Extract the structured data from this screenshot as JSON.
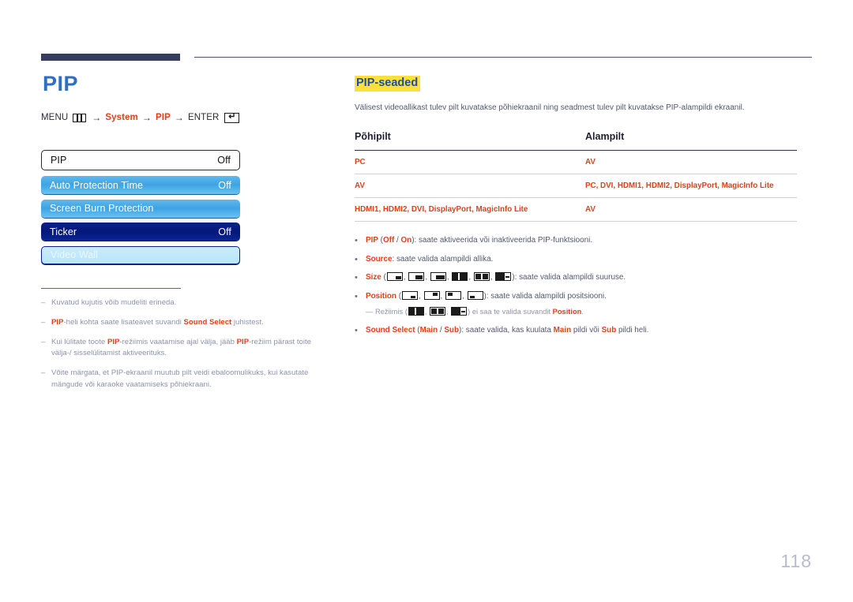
{
  "page": {
    "number": "118"
  },
  "left": {
    "title": "PIP",
    "menu_path": {
      "menu_label": "MENU",
      "menu_icon": "menu-bars-icon",
      "arrow": "→",
      "step1": "System",
      "step2": "PIP",
      "enter_label": "ENTER",
      "enter_icon": "enter-key-icon",
      "enter_glyph": "↵"
    },
    "osd": {
      "rows": [
        {
          "label": "PIP",
          "value": "Off",
          "style": "first"
        },
        {
          "label": "Auto Protection Time",
          "value": "Off",
          "style": "lightblue"
        },
        {
          "label": "Screen Burn Protection",
          "value": "",
          "style": "lightblue"
        },
        {
          "label": "Ticker",
          "value": "Off",
          "style": "darkblue"
        },
        {
          "label": "Video Wall",
          "value": "",
          "style": "paleblue"
        }
      ]
    },
    "notes": [
      {
        "dash": "–",
        "parts": [
          {
            "t": "Kuvatud kujutis võib mudeliti erineda.",
            "b": false
          }
        ]
      },
      {
        "dash": "–",
        "parts": [
          {
            "t": "PIP",
            "b": true
          },
          {
            "t": "-heli kohta saate lisateavet suvandi ",
            "b": false
          },
          {
            "t": "Sound Select",
            "b": true
          },
          {
            "t": " juhistest.",
            "b": false
          }
        ]
      },
      {
        "dash": "–",
        "parts": [
          {
            "t": "Kui lülitate toote ",
            "b": false
          },
          {
            "t": "PIP",
            "b": true
          },
          {
            "t": "-režiimis vaatamise ajal välja, jääb ",
            "b": false
          },
          {
            "t": "PIP",
            "b": true
          },
          {
            "t": "-režiim pärast toite välja-/ sisselülitamist aktiveerituks.",
            "b": false
          }
        ]
      },
      {
        "dash": "–",
        "parts": [
          {
            "t": "Võite märgata, et PIP-ekraanil muutub pilt veidi ebaloomulikuks, kui kasutate mängude või karaoke vaatamiseks põhiekraani.",
            "b": false
          }
        ]
      }
    ]
  },
  "right": {
    "section_title": "PIP-seaded",
    "section_desc": "Välisest videoallikast tulev pilt kuvatakse põhiekraanil ning seadmest tulev pilt kuvatakse PIP-alampildi ekraanil.",
    "table": {
      "headers": [
        "Põhipilt",
        "Alampilt"
      ],
      "rows": [
        [
          "PC",
          "AV"
        ],
        [
          "AV",
          "PC, DVI, HDMI1, HDMI2, DisplayPort, MagicInfo Lite"
        ],
        [
          "HDMI1, HDMI2, DVI, DisplayPort, MagicInfo Lite",
          "AV"
        ]
      ]
    },
    "bullets": [
      {
        "dot": "•",
        "parts": [
          {
            "t": "PIP",
            "b": true
          },
          {
            "t": " (",
            "b": false
          },
          {
            "t": "Off",
            "b": true
          },
          {
            "t": " / ",
            "b": false
          },
          {
            "t": "On",
            "b": true
          },
          {
            "t": "): saate aktiveerida või inaktiveerida PIP-funktsiooni.",
            "b": false
          }
        ]
      },
      {
        "dot": "•",
        "parts": [
          {
            "t": "Source",
            "b": true
          },
          {
            "t": ": saate valida alampildi allika.",
            "b": false
          }
        ]
      }
    ],
    "size_bullet": {
      "dot": "•",
      "label": "Size",
      "open": " (",
      "sep": ", ",
      "close": "): ",
      "tail": "saate valida alampildi suuruse.",
      "icons": [
        "pip-size-small-icon",
        "pip-size-medium-icon",
        "pip-size-large-icon",
        "pip-size-split-wide-icon",
        "pip-size-split-even-icon",
        "pip-size-split-narrow-icon"
      ]
    },
    "position_bullet": {
      "dot": "•",
      "label": "Position",
      "open": " (",
      "sep": ", ",
      "close": "): ",
      "tail": "saate valida alampildi positsiooni.",
      "icons": [
        "pip-position-bottom-right-icon",
        "pip-position-top-right-icon",
        "pip-position-top-left-icon",
        "pip-position-bottom-left-icon"
      ]
    },
    "position_subnote": {
      "dash": "—",
      "pre": "Režiimis (",
      "sep": ", ",
      "mid": ") ei saa te valida suvandit ",
      "bold_end": "Position",
      "end": ".",
      "icons": [
        "pip-size-split-wide-icon",
        "pip-size-split-even-icon",
        "pip-size-split-narrow-icon"
      ]
    },
    "sound_bullet": {
      "dot": "•",
      "parts": [
        {
          "t": "Sound Select",
          "b": true
        },
        {
          "t": " (",
          "b": false
        },
        {
          "t": "Main",
          "b": true
        },
        {
          "t": " / ",
          "b": false
        },
        {
          "t": "Sub",
          "b": true
        },
        {
          "t": "): saate valida, kas kuulata ",
          "b": false
        },
        {
          "t": "Main",
          "b": true
        },
        {
          "t": " pildi või ",
          "b": false
        },
        {
          "t": "Sub",
          "b": true
        },
        {
          "t": " pildi heli.",
          "b": false
        }
      ]
    }
  },
  "colors": {
    "accent_red": "#e0401c",
    "title_blue": "#2e6fc4",
    "highlight_yellow": "#ffdf3a",
    "header_navy": "#353c5e"
  }
}
